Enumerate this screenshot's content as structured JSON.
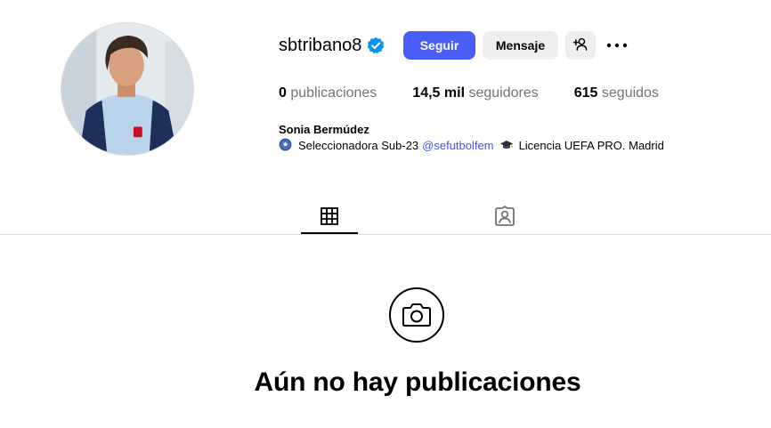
{
  "profile": {
    "username": "sbtribano8",
    "verified": true,
    "full_name": "Sonia Bermúdez",
    "bio": {
      "part1": "Seleccionadora Sub-23",
      "mention": "@sefutbolfem",
      "part2": "Licencia UEFA PRO. Madrid"
    }
  },
  "actions": {
    "follow_label": "Seguir",
    "message_label": "Mensaje",
    "add_user_icon": "person-add-icon",
    "more_icon": "more-horizontal-icon"
  },
  "stats": {
    "posts_count": "0",
    "posts_label": "publicaciones",
    "followers_count": "14,5 mil",
    "followers_label": "seguidores",
    "following_count": "615",
    "following_label": "seguidos"
  },
  "tabs": [
    {
      "icon": "grid-icon",
      "active": true
    },
    {
      "icon": "tagged-person-icon",
      "active": false
    }
  ],
  "empty_state": {
    "icon": "camera-icon",
    "title": "Aún no hay publicaciones"
  },
  "colors": {
    "accent": "#4a5df9",
    "verified_badge": "#0095f6",
    "secondary_button": "#efefef",
    "mention": "#4150f7",
    "muted_text": "#737373"
  }
}
